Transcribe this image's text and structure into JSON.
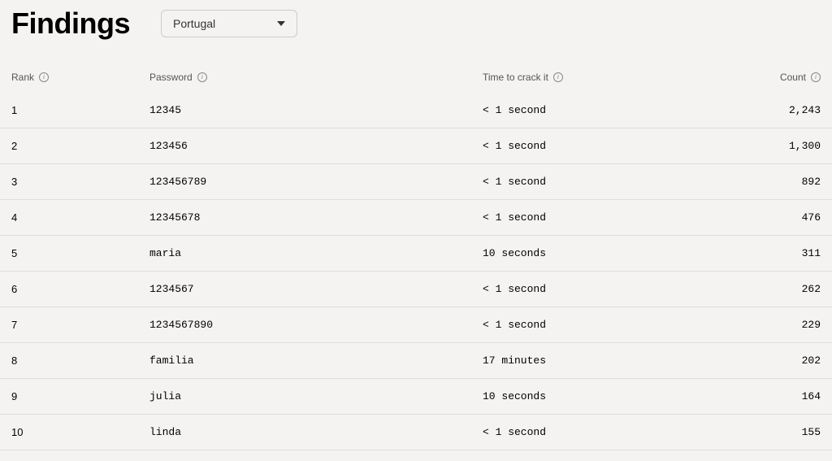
{
  "title": "Findings",
  "dropdown": {
    "selected": "Portugal"
  },
  "columns": {
    "rank": "Rank",
    "password": "Password",
    "time": "Time to crack it",
    "count": "Count"
  },
  "rows": [
    {
      "rank": "1",
      "password": "12345",
      "time": "< 1 second",
      "count": "2,243"
    },
    {
      "rank": "2",
      "password": "123456",
      "time": "< 1 second",
      "count": "1,300"
    },
    {
      "rank": "3",
      "password": "123456789",
      "time": "< 1 second",
      "count": "892"
    },
    {
      "rank": "4",
      "password": "12345678",
      "time": "< 1 second",
      "count": "476"
    },
    {
      "rank": "5",
      "password": "maria",
      "time": "10 seconds",
      "count": "311"
    },
    {
      "rank": "6",
      "password": "1234567",
      "time": "< 1 second",
      "count": "262"
    },
    {
      "rank": "7",
      "password": "1234567890",
      "time": "< 1 second",
      "count": "229"
    },
    {
      "rank": "8",
      "password": "familia",
      "time": "17 minutes",
      "count": "202"
    },
    {
      "rank": "9",
      "password": "julia",
      "time": "10 seconds",
      "count": "164"
    },
    {
      "rank": "10",
      "password": "linda",
      "time": "< 1 second",
      "count": "155"
    }
  ]
}
